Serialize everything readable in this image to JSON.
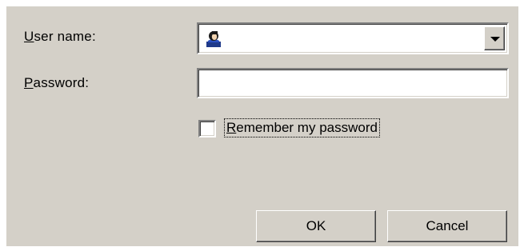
{
  "form": {
    "username_label": "User name:",
    "password_label": "Password:",
    "username_value": "",
    "password_value": "",
    "username_icon": "user-avatar-icon",
    "remember_label": "Remember my password",
    "remember_checked": false
  },
  "buttons": {
    "ok_label": "OK",
    "cancel_label": "Cancel"
  },
  "colors": {
    "dialog_bg": "#d4d0c8",
    "field_bg": "#ffffff"
  }
}
